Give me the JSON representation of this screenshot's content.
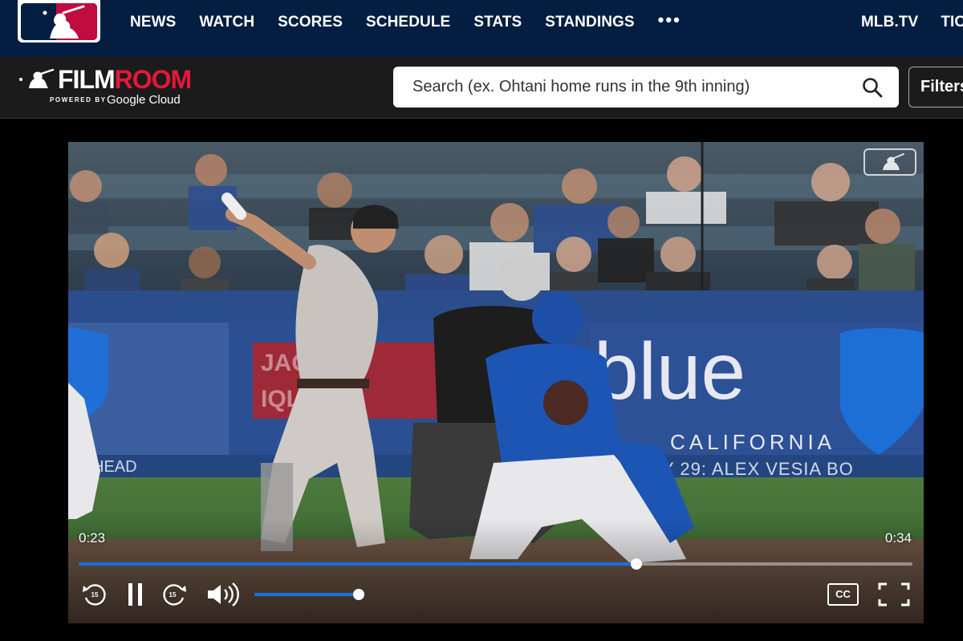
{
  "nav": {
    "items": [
      "NEWS",
      "WATCH",
      "SCORES",
      "SCHEDULE",
      "STATS",
      "STANDINGS"
    ],
    "more": "•••",
    "right_items": [
      "MLB.TV",
      "TICKETS"
    ]
  },
  "filmroom": {
    "brand_film": "FILM",
    "brand_room": "ROOM",
    "powered_by": "POWERED BY",
    "google_cloud": "Google Cloud",
    "search_placeholder": "Search (ex. Ohtani home runs in the 9th inning)",
    "filters_label": "Filters"
  },
  "player": {
    "time_current": "0:23",
    "time_total": "0:34",
    "progress_fraction": 0.669,
    "volume_fraction": 1.0,
    "skip_back_seconds": "15",
    "skip_forward_seconds": "15",
    "cc_label": "CC",
    "state": "playing"
  },
  "colors": {
    "nav_bg": "#041e42",
    "filmbar_bg": "#1b1b1b",
    "accent_red": "#e31937",
    "progress_blue": "#1d6fd8"
  }
}
